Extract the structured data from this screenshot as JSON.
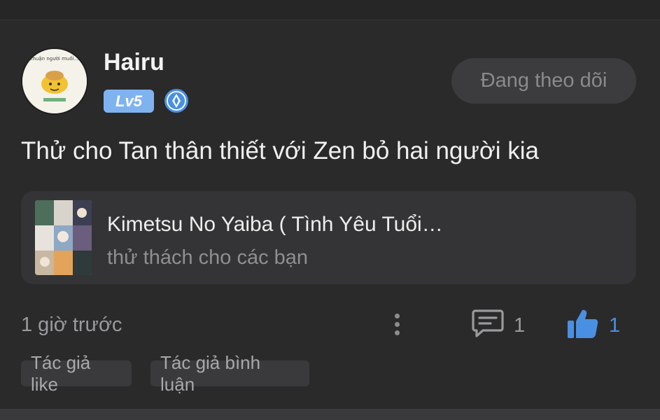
{
  "post": {
    "author": {
      "name": "Hairu",
      "level": "Lv5",
      "avatar_caption": "thuận người muối..."
    },
    "follow_label": "Đang theo dõi",
    "text": "Thử cho Tan thân thiết với Zen bỏ hai người kia",
    "book": {
      "title": "Kimetsu No Yaiba ( Tình Yêu Tuổi…",
      "subtitle": "thử thách cho các bạn"
    },
    "time": "1 giờ trước",
    "comment_count": "1",
    "like_count": "1",
    "tags": [
      "Tác giả like",
      "Tác giả bình luận"
    ]
  },
  "colors": {
    "background": "#2a2a2b",
    "card": "#343436",
    "accent_blue": "#4a90e2",
    "level_badge": "#7fb3f0",
    "muted_text": "#9a9a9d"
  },
  "icons": {
    "rank": "diamond-rank-icon",
    "more": "vertical-dots-icon",
    "comment": "comment-bubble-icon",
    "like": "thumbs-up-icon"
  }
}
